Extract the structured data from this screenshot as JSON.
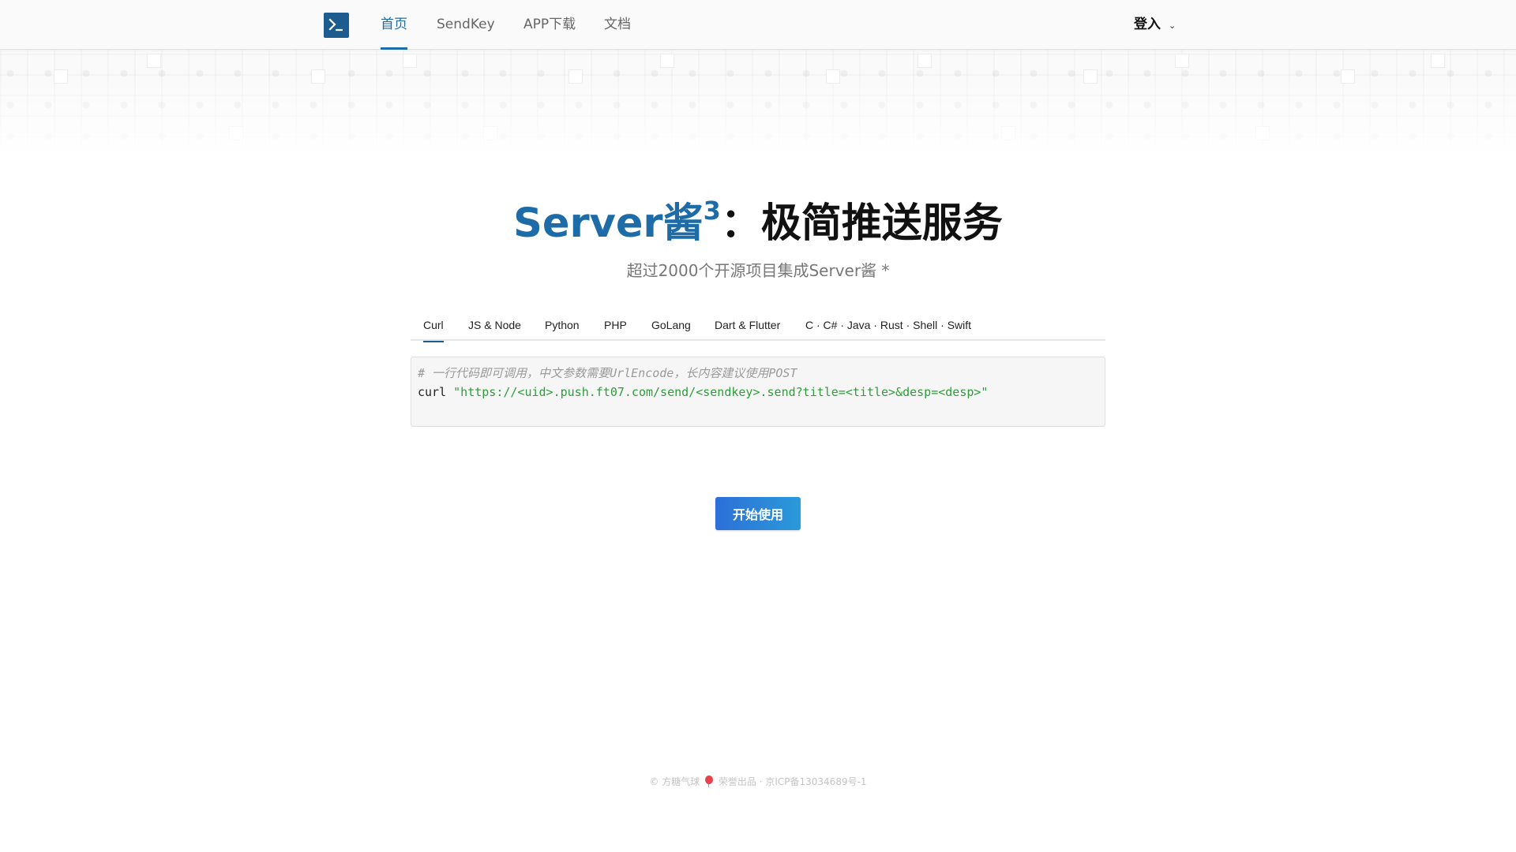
{
  "nav": {
    "logo_icon": "terminal-icon",
    "items": [
      {
        "label": "首页",
        "active": true
      },
      {
        "label": "SendKey",
        "active": false
      },
      {
        "label": "APP下载",
        "active": false
      },
      {
        "label": "文档",
        "active": false
      }
    ],
    "login_label": "登入",
    "login_icon": "chevron-down-icon"
  },
  "hero": {
    "brand": "Server酱",
    "superscript": "3",
    "tagline": "：极简推送服务",
    "subtitle": "超过2000个开源项目集成Server酱 *"
  },
  "tabs": [
    {
      "label": "Curl",
      "active": true
    },
    {
      "label": "JS & Node",
      "active": false
    },
    {
      "label": "Python",
      "active": false
    },
    {
      "label": "PHP",
      "active": false
    },
    {
      "label": "GoLang",
      "active": false
    },
    {
      "label": "Dart & Flutter",
      "active": false
    },
    {
      "label": "C · C# · Java · Rust · Shell · Swift",
      "active": false
    }
  ],
  "code": {
    "comment": "# 一行代码即可调用，中文参数需要UrlEncode，长内容建议使用POST",
    "command": "curl ",
    "url": "\"https://<uid>.push.ft07.com/send/<sendkey>.send?title=<title>&desp=<desp>\""
  },
  "start_button": "开始使用",
  "footer": {
    "prefix": "© 方糖气球",
    "suffix": "荣誉出品 · 京ICP备13034689号-1"
  },
  "colors": {
    "brand_blue": "#1d6ca8",
    "logo_bg": "#1d5c8e",
    "button_start": "#2c6fd8",
    "button_end": "#2b9ad9",
    "code_string": "#2e9d3a"
  }
}
